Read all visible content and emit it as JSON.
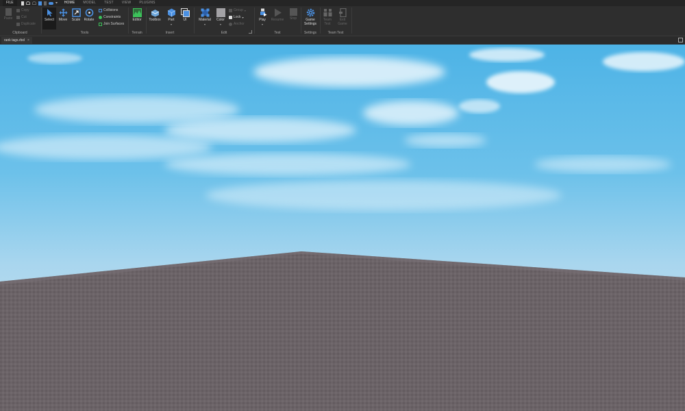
{
  "menu": {
    "file": "FILE",
    "tabs": [
      "HOME",
      "MODEL",
      "TEST",
      "VIEW",
      "PLUGINS"
    ],
    "active_tab": "HOME"
  },
  "ribbon": {
    "clipboard": {
      "paste": "Paste",
      "copy": "Copy",
      "cut": "Cut",
      "duplicate": "Duplicate",
      "label": "Clipboard"
    },
    "tools": {
      "select": "Select",
      "move": "Move",
      "scale": "Scale",
      "rotate": "Rotate",
      "collisions": "Collisions",
      "constraints": "Constraints",
      "join_surfaces": "Join Surfaces",
      "label": "Tools"
    },
    "terrain": {
      "editor": "Editor",
      "label": "Terrain"
    },
    "insert": {
      "toolbox": "Toolbox",
      "part": "Part",
      "ui": "UI",
      "label": "Insert"
    },
    "edit": {
      "material": "Material",
      "color": "Color",
      "group": "Group",
      "lock": "Lock",
      "anchor": "Anchor",
      "label": "Edit"
    },
    "test": {
      "play": "Play",
      "resume": "Resume",
      "stop": "Stop",
      "label": "Test"
    },
    "settings": {
      "game_settings_1": "Game",
      "game_settings_2": "Settings",
      "label": "Settings"
    },
    "team_test": {
      "team_1": "Team",
      "team_2": "Test",
      "exit_1": "Exit",
      "exit_2": "Game",
      "label": "Team Test"
    }
  },
  "document_tab": {
    "title": "rank tags.rbxl",
    "close": "×"
  },
  "colors": {
    "sky_top": "#4fb6e8",
    "sky_horizon": "#d5e4ee",
    "baseplate": "#6b6367",
    "ribbon_bg": "#2e2e2e",
    "accent_blue": "#4a90e2",
    "terrain_green": "#3cc15a"
  }
}
